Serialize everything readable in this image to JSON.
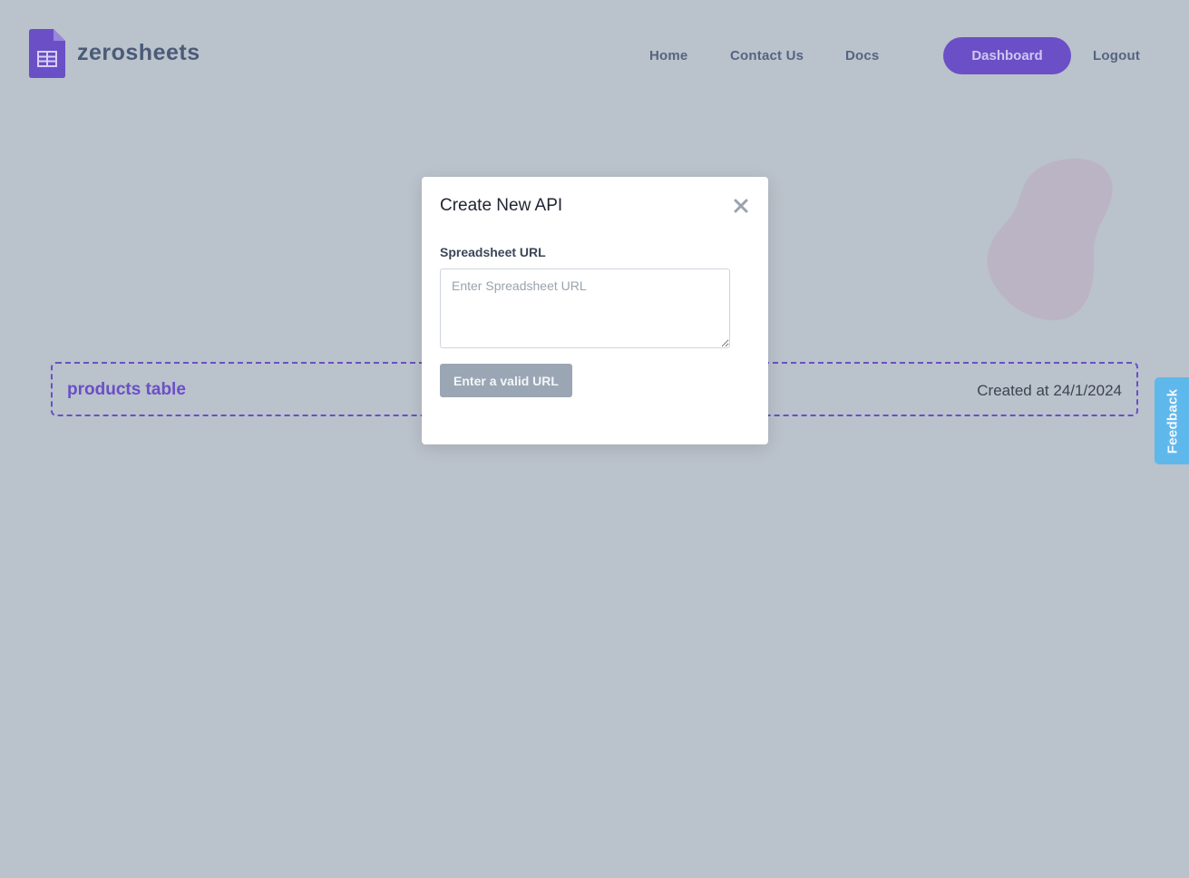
{
  "brand": {
    "name": "zerosheets",
    "accent_color": "#6a4fc7",
    "logo_icon": "spreadsheet-file-icon"
  },
  "nav": {
    "home": "Home",
    "contact": "Contact Us",
    "docs": "Docs",
    "dashboard": "Dashboard",
    "logout": "Logout"
  },
  "apis": [
    {
      "name": "products table",
      "created": "Created at 24/1/2024"
    }
  ],
  "feedback": {
    "label": "Feedback",
    "color": "#5fb8ec"
  },
  "modal": {
    "title": "Create New API",
    "close_icon": "close-icon",
    "field_label": "Spreadsheet URL",
    "input_placeholder": "Enter Spreadsheet URL",
    "input_value": "",
    "submit_label": "Enter a valid URL"
  }
}
